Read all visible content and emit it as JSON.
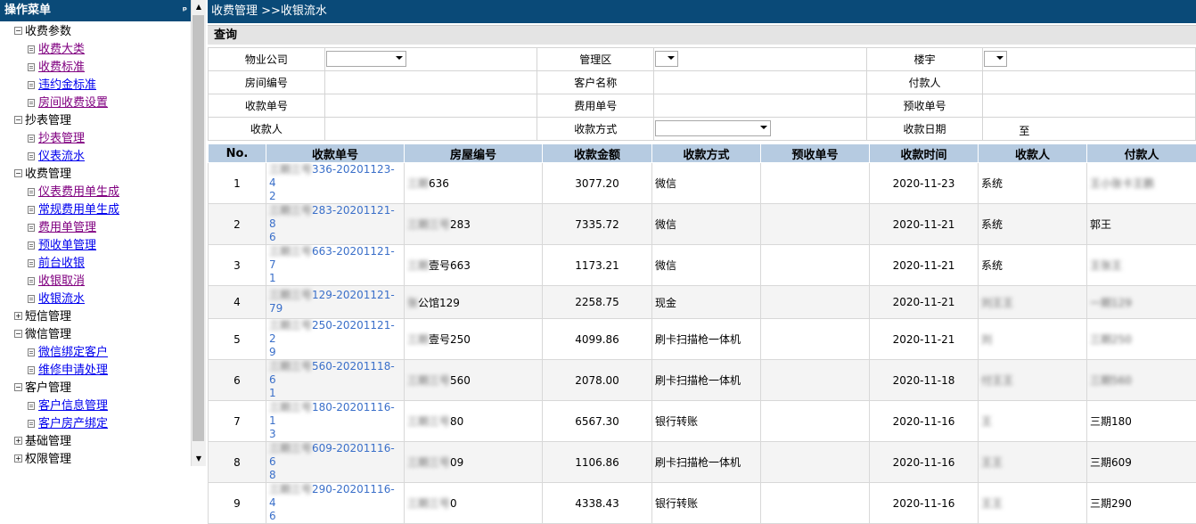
{
  "sidebar": {
    "title": "操作菜单",
    "pin_glyph": "ᵖ",
    "groups": [
      {
        "label": "收费参数",
        "expanded": true,
        "items": [
          "收费大类",
          "收费标准",
          "违约金标准",
          "房间收费设置"
        ]
      },
      {
        "label": "抄表管理",
        "expanded": true,
        "items": [
          "抄表管理",
          "仪表流水"
        ]
      },
      {
        "label": "收费管理",
        "expanded": true,
        "items": [
          "仪表费用单生成",
          "常规费用单生成",
          "费用单管理",
          "预收单管理",
          "前台收银",
          "收银取消",
          "收银流水"
        ]
      },
      {
        "label": "短信管理",
        "expanded": false,
        "items": []
      },
      {
        "label": "微信管理",
        "expanded": true,
        "items": [
          "微信绑定客户",
          "维修申请处理"
        ]
      },
      {
        "label": "客户管理",
        "expanded": true,
        "items": [
          "客户信息管理",
          "客户房产绑定"
        ]
      },
      {
        "label": "基础管理",
        "expanded": false,
        "items": []
      },
      {
        "label": "权限管理",
        "expanded": false,
        "items": []
      }
    ]
  },
  "breadcrumb": "收费管理 >>收银流水",
  "query": {
    "title": "查询",
    "rows": [
      [
        {
          "label": "物业公司",
          "type": "select",
          "value": ""
        },
        {
          "label": "管理区",
          "type": "select",
          "value": ""
        },
        {
          "label": "楼宇",
          "type": "select",
          "value": ""
        }
      ],
      [
        {
          "label": "房间编号",
          "type": "text",
          "value": ""
        },
        {
          "label": "客户名称",
          "type": "text",
          "value": ""
        },
        {
          "label": "付款人",
          "type": "text",
          "value": ""
        }
      ],
      [
        {
          "label": "收款单号",
          "type": "text",
          "value": ""
        },
        {
          "label": "费用单号",
          "type": "text",
          "value": ""
        },
        {
          "label": "预收单号",
          "type": "text",
          "value": ""
        }
      ],
      [
        {
          "label": "收款人",
          "type": "text",
          "value": ""
        },
        {
          "label": "收款方式",
          "type": "select",
          "value": ""
        },
        {
          "label": "收款日期",
          "type": "daterange",
          "value": "至"
        }
      ]
    ]
  },
  "grid": {
    "columns": [
      "No.",
      "收款单号",
      "房屋编号",
      "收款金额",
      "收款方式",
      "预收单号",
      "收款时间",
      "收款人",
      "付款人"
    ],
    "rows": [
      {
        "no": "1",
        "receipt_blur": "三期三号",
        "receipt": "336-20201123-4",
        "receipt2": "2",
        "room_blur": "三期",
        "room": "636",
        "amount": "3077.20",
        "method": "微信",
        "prepay": "",
        "time": "2020-11-23",
        "payee": "系统",
        "payee_blur": "",
        "payer_blur": "王小张卡王鹏",
        "payer": ""
      },
      {
        "no": "2",
        "receipt_blur": "三期三号",
        "receipt": "283-20201121-8",
        "receipt2": "6",
        "room_blur": "三期三号",
        "room": "283",
        "amount": "7335.72",
        "method": "微信",
        "prepay": "",
        "time": "2020-11-21",
        "payee": "系统",
        "payee_blur": "",
        "payer_blur": "",
        "payer": "郭王"
      },
      {
        "no": "3",
        "receipt_blur": "三期三号",
        "receipt": "663-20201121-7",
        "receipt2": "1",
        "room_blur": "三期",
        "room": "壹号663",
        "amount": "1173.21",
        "method": "微信",
        "prepay": "",
        "time": "2020-11-21",
        "payee": "系统",
        "payee_blur": "",
        "payer_blur": "王张王",
        "payer": ""
      },
      {
        "no": "4",
        "receipt_blur": "三期三号",
        "receipt": "129-20201121-",
        "receipt2": "79",
        "room_blur": "张",
        "room": "公馆129",
        "amount": "2258.75",
        "method": "现金",
        "prepay": "",
        "time": "2020-11-21",
        "payee": "",
        "payee_blur": "刘王王",
        "payer_blur": "一期129",
        "payer": ""
      },
      {
        "no": "5",
        "receipt_blur": "三期三号",
        "receipt": "250-20201121-2",
        "receipt2": "9",
        "room_blur": "三期",
        "room": "壹号250",
        "amount": "4099.86",
        "method": "刷卡扫描枪一体机",
        "prepay": "",
        "time": "2020-11-21",
        "payee": "",
        "payee_blur": "刘",
        "payer_blur": "三期250",
        "payer": ""
      },
      {
        "no": "6",
        "receipt_blur": "三期三号",
        "receipt": "560-20201118-6",
        "receipt2": "1",
        "room_blur": "三期三号",
        "room": "560",
        "amount": "2078.00",
        "method": "刷卡扫描枪一体机",
        "prepay": "",
        "time": "2020-11-18",
        "payee": "",
        "payee_blur": "付王王",
        "payer_blur": "三期560",
        "payer": ""
      },
      {
        "no": "7",
        "receipt_blur": "三期三号",
        "receipt": "180-20201116-1",
        "receipt2": "3",
        "room_blur": "三期三号",
        "room": "80",
        "amount": "6567.30",
        "method": "银行转账",
        "prepay": "",
        "time": "2020-11-16",
        "payee": "",
        "payee_blur": "王",
        "payer_blur": "",
        "payer": "三期180"
      },
      {
        "no": "8",
        "receipt_blur": "三期三号",
        "receipt": "609-20201116-6",
        "receipt2": "8",
        "room_blur": "三期三号",
        "room": "09",
        "amount": "1106.86",
        "method": "刷卡扫描枪一体机",
        "prepay": "",
        "time": "2020-11-16",
        "payee": "",
        "payee_blur": "王王",
        "payer_blur": "",
        "payer": "三期609"
      },
      {
        "no": "9",
        "receipt_blur": "三期三号",
        "receipt": "290-20201116-4",
        "receipt2": "6",
        "room_blur": "三期三号",
        "room": "0",
        "amount": "4338.43",
        "method": "银行转账",
        "prepay": "",
        "time": "2020-11-16",
        "payee": "",
        "payee_blur": "王王",
        "payer_blur": "",
        "payer": "三期290"
      }
    ]
  },
  "scrollbar": {
    "up": "▲",
    "down": "▼"
  },
  "toggle_glyphs": {
    "expanded": "−",
    "collapsed": "+"
  }
}
